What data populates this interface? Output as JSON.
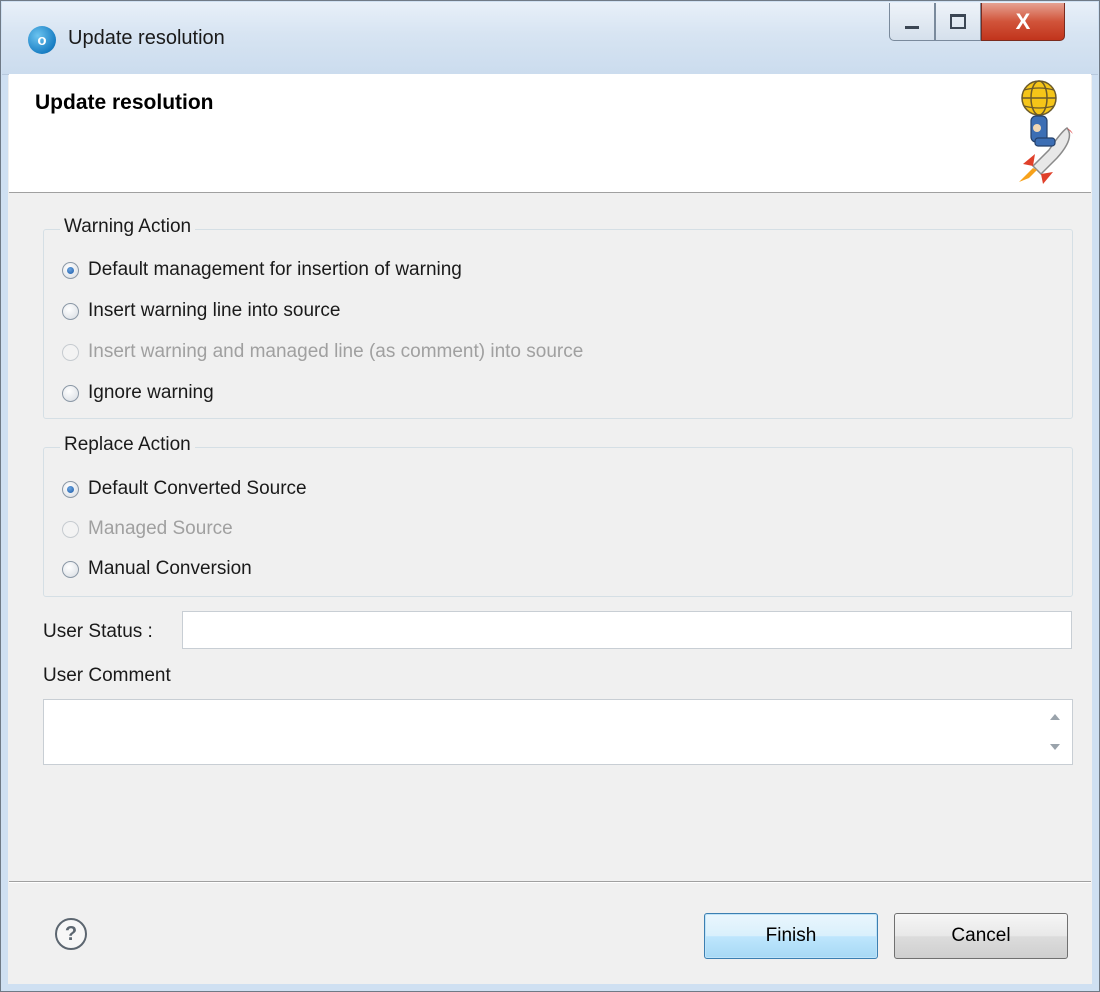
{
  "window": {
    "title": "Update resolution",
    "controls": {
      "minimize": "minimize",
      "maximize": "maximize",
      "close": "X"
    }
  },
  "header": {
    "title": "Update resolution",
    "image_icon": "rocket-rider-icon"
  },
  "warning_group": {
    "legend": "Warning Action",
    "options": [
      {
        "label": "Default management for insertion of warning",
        "checked": true,
        "enabled": true
      },
      {
        "label": "Insert warning line into source",
        "checked": false,
        "enabled": true
      },
      {
        "label": "Insert warning and managed line (as comment) into source",
        "checked": false,
        "enabled": false
      },
      {
        "label": "Ignore warning",
        "checked": false,
        "enabled": true
      }
    ]
  },
  "replace_group": {
    "legend": "Replace Action",
    "options": [
      {
        "label": "Default Converted Source",
        "checked": true,
        "enabled": true
      },
      {
        "label": "Managed Source",
        "checked": false,
        "enabled": false
      },
      {
        "label": "Manual Conversion",
        "checked": false,
        "enabled": true
      }
    ]
  },
  "user_status": {
    "label": "User Status :",
    "value": ""
  },
  "user_comment": {
    "label": "User Comment",
    "value": ""
  },
  "footer": {
    "help_icon": "?",
    "finish": "Finish",
    "cancel": "Cancel"
  },
  "colors": {
    "accent": "#3c7fb1",
    "close_button": "#c1341c",
    "disabled_text": "#a0a0a0"
  }
}
